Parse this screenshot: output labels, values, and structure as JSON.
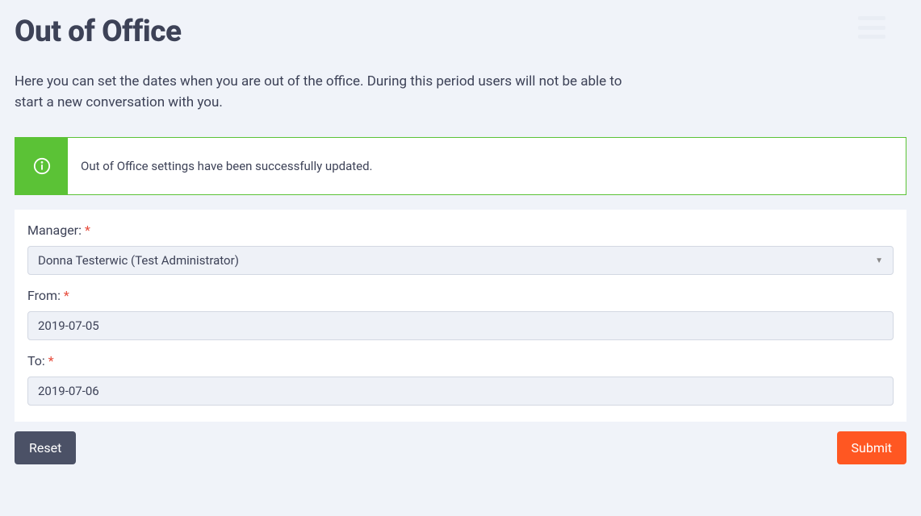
{
  "header": {
    "title": "Out of Office"
  },
  "description": "Here you can set the dates when you are out of the office. During this period users will not be able to start a new conversation with you.",
  "alert": {
    "message": "Out of Office settings have been successfully updated."
  },
  "form": {
    "manager": {
      "label": "Manager:",
      "value": "Donna Testerwic (Test Administrator)"
    },
    "from": {
      "label": "From:",
      "value": "2019-07-05"
    },
    "to": {
      "label": "To:",
      "value": "2019-07-06"
    }
  },
  "buttons": {
    "reset": "Reset",
    "submit": "Submit"
  }
}
